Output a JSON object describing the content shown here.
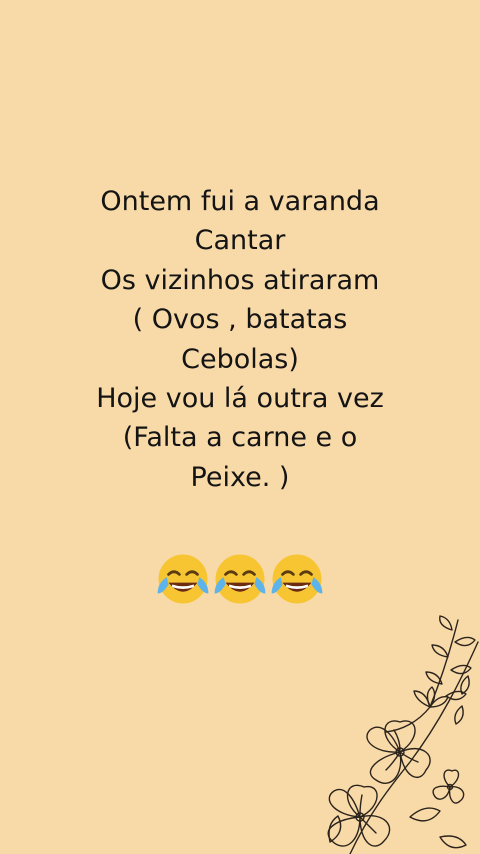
{
  "post": {
    "lines": [
      "Ontem fui a varanda",
      "Cantar",
      "Os vizinhos atiraram",
      "( Ovos , batatas",
      "Cebolas)",
      "Hoje vou lá outra vez",
      "(Falta a carne e o",
      "Peixe. )"
    ],
    "emojis": [
      "face-with-tears-of-joy-icon",
      "face-with-tears-of-joy-icon",
      "face-with-tears-of-joy-icon"
    ]
  },
  "colors": {
    "background": "#f8d9a8",
    "text": "#141414",
    "emoji_face": "#f7c531",
    "tears": "#5db3ea",
    "floral_line": "#2b241c"
  }
}
